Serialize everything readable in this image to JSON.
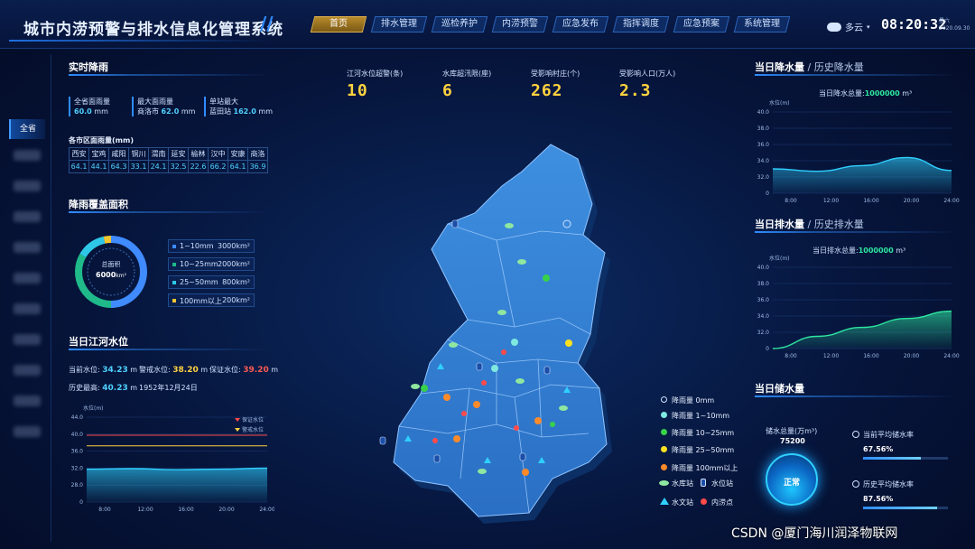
{
  "header": {
    "title": "城市内涝预警与排水信息化管理系统",
    "nav": [
      "首页",
      "排水管理",
      "巡检养护",
      "内涝预警",
      "应急发布",
      "指挥调度",
      "应急预案",
      "系统管理"
    ],
    "active_nav": "首页",
    "weather": "多云",
    "time": "08:20:32",
    "weekday": "星六",
    "date": "2020.09.30"
  },
  "sidebar": {
    "active_label": "全省"
  },
  "realtime_rain": {
    "title": "实时降雨",
    "stats": [
      {
        "label": "全省面雨量",
        "value": "60.0",
        "unit": "mm"
      },
      {
        "label": "最大面雨量",
        "place": "商洛市",
        "value": "62.0",
        "unit": "mm"
      },
      {
        "label": "单站最大",
        "place": "蓝田站",
        "value": "162.0",
        "unit": "mm"
      }
    ],
    "table_title": "各市区面雨量(mm)",
    "cities": [
      "西安",
      "宝鸡",
      "咸阳",
      "铜川",
      "渭南",
      "延安",
      "榆林",
      "汉中",
      "安康",
      "商洛"
    ],
    "values": [
      "64.1",
      "44.1",
      "64.3",
      "33.1",
      "24.1",
      "32.5",
      "22.6",
      "66.2",
      "64.1",
      "36.9"
    ]
  },
  "coverage": {
    "title": "降雨覆盖面积",
    "center_label": "总面积",
    "center_value": "6000",
    "center_unit": "km²",
    "items": [
      {
        "label": "1~10mm",
        "value": "3000km²",
        "color": "#3f8bff"
      },
      {
        "label": "10~25mm",
        "value": "2000km²",
        "color": "#1fb98a"
      },
      {
        "label": "25~50mm",
        "value": "800km²",
        "color": "#2ec7e8"
      },
      {
        "label": "100mm以上",
        "value": "200km²",
        "color": "#f2c531"
      }
    ],
    "chart_data": {
      "type": "pie",
      "categories": [
        "1~10mm",
        "10~25mm",
        "25~50mm",
        "100mm以上"
      ],
      "values": [
        3000,
        2000,
        800,
        200
      ]
    }
  },
  "river_level": {
    "title": "当日江河水位",
    "current_label": "当前水位:",
    "current_value": "34.23",
    "warning_label": "警戒水位:",
    "warning_value": "38.20",
    "guarantee_label": "保证水位:",
    "guarantee_value": "39.20",
    "unit": "m",
    "record_label": "历史最高:",
    "record_value": "40.23",
    "record_date": "1952年12月24日",
    "chart": {
      "ylabel": "水位(m)",
      "legend": [
        "保证水位",
        "警戒水位"
      ],
      "yticks": [
        "44.0",
        "40.0",
        "36.0",
        "32.0",
        "28.0",
        "0"
      ],
      "xticks": [
        "8:00",
        "12:00",
        "16:00",
        "20:00",
        "24:00"
      ]
    },
    "chart_data": {
      "type": "area",
      "x": [
        "8:00",
        "12:00",
        "16:00",
        "20:00",
        "24:00"
      ],
      "series": [
        {
          "name": "水位",
          "values": [
            34.2,
            34.3,
            34.1,
            34.2,
            34.4
          ]
        },
        {
          "name": "保证水位",
          "values": [
            40.6,
            40.6,
            40.6,
            40.6,
            40.6
          ]
        },
        {
          "name": "警戒水位",
          "values": [
            38.6,
            38.6,
            38.6,
            38.6,
            38.6
          ]
        }
      ],
      "ylim": [
        28,
        44
      ]
    }
  },
  "kpis": [
    {
      "label": "江河水位超警(条)",
      "value": "10"
    },
    {
      "label": "水库超汛限(座)",
      "value": "6"
    },
    {
      "label": "受影响村庄(个)",
      "value": "262"
    },
    {
      "label": "受影响人口(万人)",
      "value": "2.3"
    }
  ],
  "map_legend": [
    {
      "label": "降雨量  0mm",
      "color": "#0b1f4a",
      "ring": "#cfe2ff"
    },
    {
      "label": "降雨量  1~10mm",
      "color": "#7fe9e0"
    },
    {
      "label": "降雨量  10~25mm",
      "color": "#37d24a"
    },
    {
      "label": "降雨量  25~50mm",
      "color": "#ffe21f"
    },
    {
      "label": "降雨量  100mm以上",
      "color": "#ff8a2a"
    },
    {
      "label": "水库站"
    },
    {
      "label": "水位站"
    },
    {
      "label": "水文站"
    },
    {
      "label": "内涝点"
    }
  ],
  "drainage_rain": {
    "title": "当日降水量",
    "title_muted": " / 历史降水量",
    "total_label": "当日降水总量:",
    "total_value": "1000000",
    "total_unit": "m³",
    "ylabel": "水位(m)",
    "yticks": [
      "40.0",
      "38.0",
      "36.0",
      "34.0",
      "32.0",
      "0"
    ],
    "xticks": [
      "8:00",
      "12:00",
      "16:00",
      "20:00",
      "24:00"
    ],
    "chart_data": {
      "type": "area",
      "x": [
        "8:00",
        "12:00",
        "16:00",
        "20:00",
        "24:00"
      ],
      "values": [
        33.0,
        32.7,
        33.4,
        34.4,
        32.8
      ],
      "ylim": [
        30,
        40
      ]
    }
  },
  "drainage_out": {
    "title": "当日排水量",
    "title_muted": " / 历史排水量",
    "total_label": "当日排水总量:",
    "total_value": "1000000",
    "total_unit": "m³",
    "ylabel": "水位(m)",
    "yticks": [
      "40.0",
      "38.0",
      "36.0",
      "34.0",
      "32.0",
      "0"
    ],
    "xticks": [
      "8:00",
      "12:00",
      "16:00",
      "20:00",
      "24:00"
    ],
    "chart_data": {
      "type": "area",
      "x": [
        "8:00",
        "12:00",
        "16:00",
        "20:00",
        "24:00"
      ],
      "values": [
        30.0,
        31.5,
        32.6,
        33.7,
        34.6
      ],
      "ylim": [
        30,
        40
      ]
    }
  },
  "storage": {
    "title": "当日储水量",
    "total_label": "储水总量(万m³)",
    "total_value": "75200",
    "status": "正常",
    "current_label": "当前平均储水率",
    "current_value": "67.56%",
    "current_fraction": 0.6756,
    "history_label": "历史平均储水率",
    "history_value": "87.56%",
    "history_fraction": 0.8756
  },
  "watermark": "CSDN @厦门海川润泽物联网"
}
